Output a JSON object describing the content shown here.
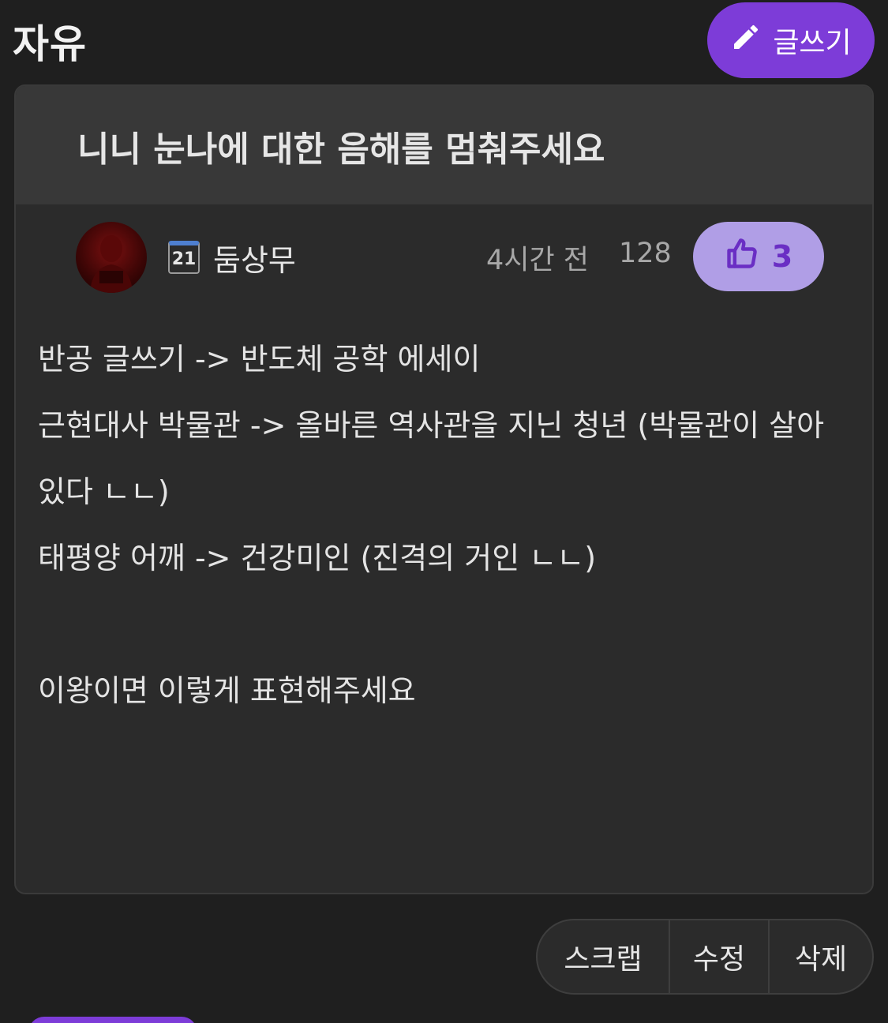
{
  "header": {
    "board_title": "자유",
    "write_button_label": "글쓰기",
    "write_icon": "pencil-icon"
  },
  "post": {
    "title": "니니 눈나에 대한 음해를 멈춰주세요",
    "author": {
      "name": "둠상무",
      "badge_number": "21",
      "badge_icon": "calendar-icon"
    },
    "time": "4시간 전",
    "views": "128",
    "likes": "3",
    "like_icon": "thumbs-up-icon",
    "body_lines": [
      "반공 글쓰기 -> 반도체 공학 에세이",
      "근현대사 박물관 -> 올바른 역사관을 지닌 청년 (박물관이 살아",
      "있다 ㄴㄴ)",
      "태평양 어깨 -> 건강미인 (진격의 거인 ㄴㄴ)",
      "",
      "이왕이면 이렇게 표현해주세요"
    ]
  },
  "actions": {
    "scrap": "스크랩",
    "edit": "수정",
    "delete": "삭제"
  },
  "colors": {
    "background": "#1f1f1f",
    "card": "#2b2b2b",
    "card_header": "#383838",
    "accent": "#7d3cd8",
    "like_bg": "#b09ee6"
  }
}
